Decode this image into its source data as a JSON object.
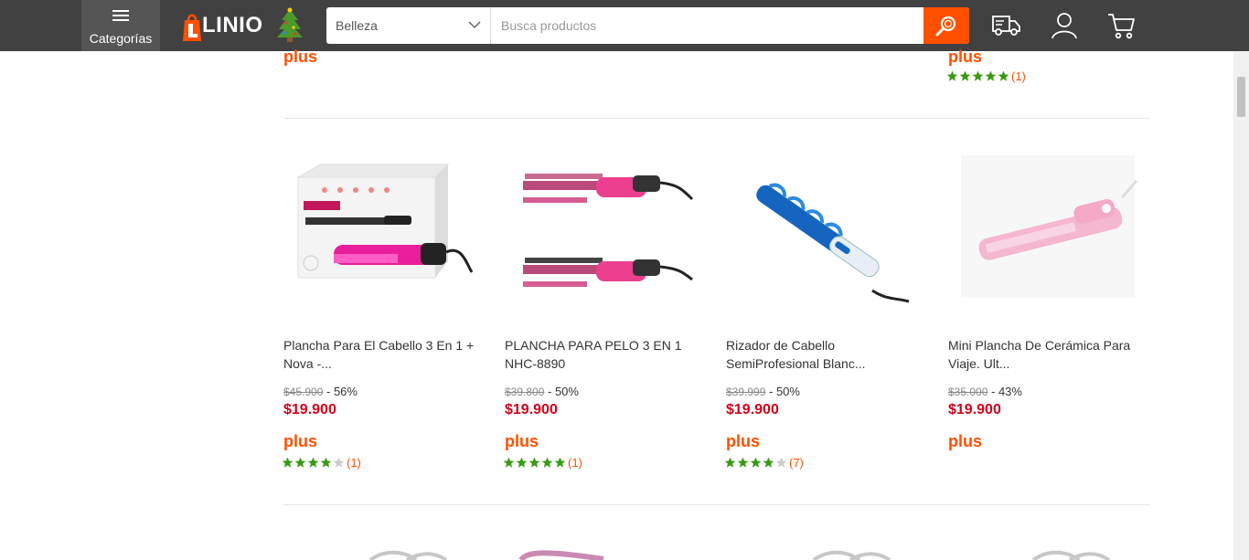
{
  "header": {
    "categories_label": "Categorías",
    "logo_text": "LINIO",
    "search_category": "Belleza",
    "search_placeholder": "Busca productos"
  },
  "top_row": {
    "plus_left": "plus",
    "plus_right": "plus",
    "right_rating": 5,
    "right_reviews": "(1)"
  },
  "products": [
    {
      "title": "Plancha Para El Cabello 3 En 1 + Nova -...",
      "old_price": "$45.900",
      "discount": "- 56%",
      "price": "$19.900",
      "plus": "plus",
      "rating": 4,
      "reviews": "(1)"
    },
    {
      "title": "PLANCHA PARA PELO 3 EN 1 NHC-8890",
      "old_price": "$39.800",
      "discount": "- 50%",
      "price": "$19.900",
      "plus": "plus",
      "rating": 5,
      "reviews": "(1)"
    },
    {
      "title": "Rizador de Cabello SemiProfesional Blanc...",
      "old_price": "$39.999",
      "discount": "- 50%",
      "price": "$19.900",
      "plus": "plus",
      "rating": 4,
      "reviews": "(7)"
    },
    {
      "title": "Mini Plancha De Cerámica Para Viaje. Ult...",
      "old_price": "$35.000",
      "discount": "- 43%",
      "price": "$19.900",
      "plus": "plus"
    }
  ],
  "colors": {
    "brand_orange": "#ff5000",
    "price_red": "#d0021b",
    "star_green": "#3a9a14",
    "header_bg": "#414141"
  }
}
